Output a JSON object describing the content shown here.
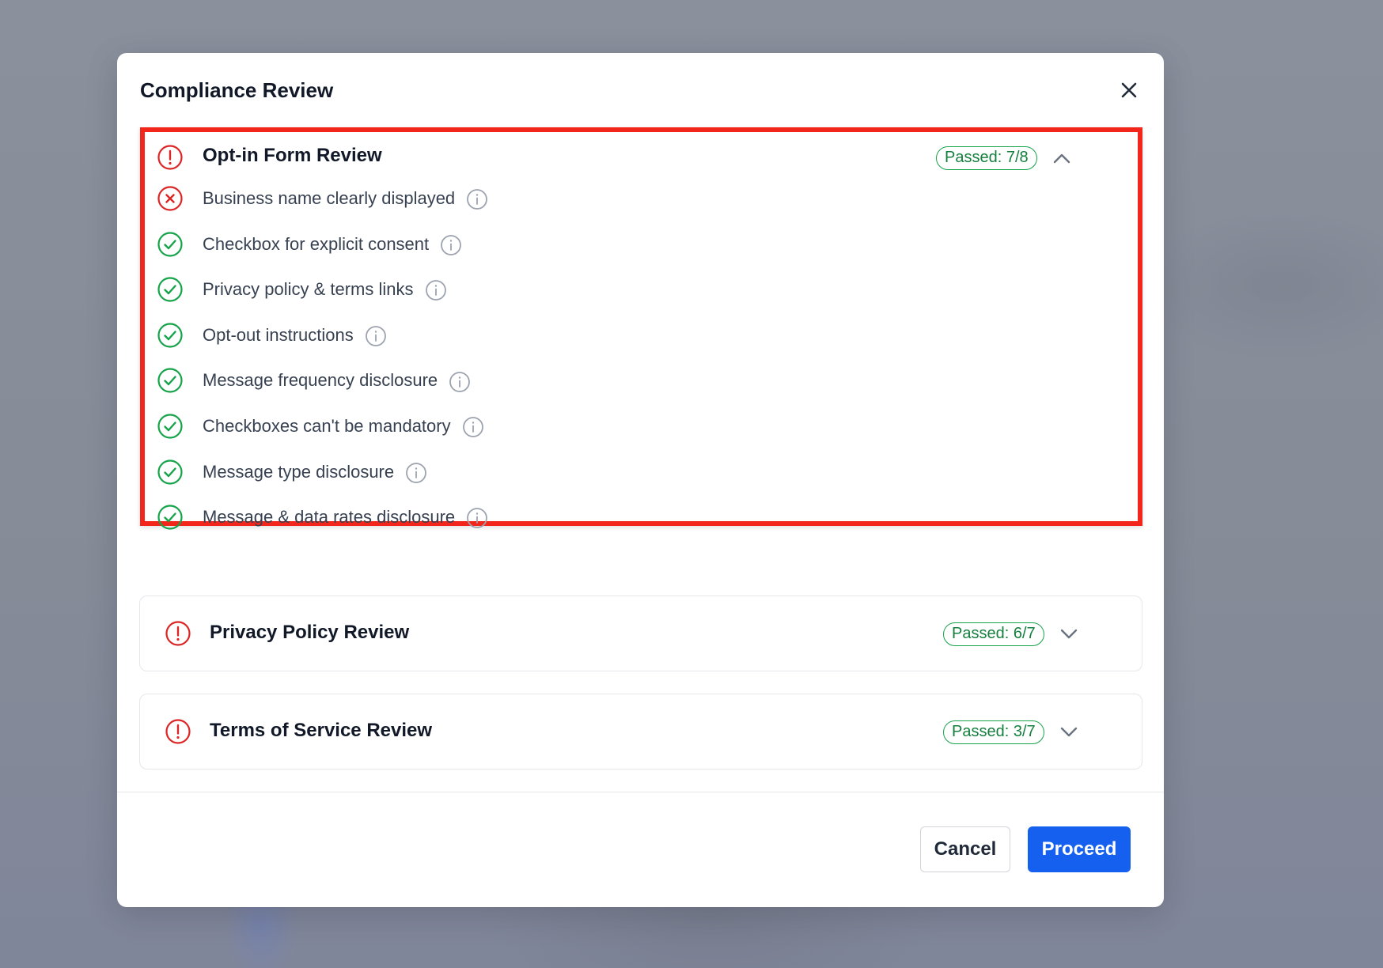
{
  "modal": {
    "title": "Compliance Review",
    "close_label": "close"
  },
  "sections": [
    {
      "title": "Opt-in Form Review",
      "badge": "Passed: 7/8",
      "status": "warning",
      "expanded": true,
      "items": [
        {
          "label": "Business name clearly displayed",
          "status": "fail"
        },
        {
          "label": "Checkbox for explicit consent",
          "status": "pass"
        },
        {
          "label": "Privacy policy & terms links",
          "status": "pass"
        },
        {
          "label": "Opt-out instructions",
          "status": "pass"
        },
        {
          "label": "Message frequency disclosure",
          "status": "pass"
        },
        {
          "label": "Checkboxes can't be mandatory",
          "status": "pass"
        },
        {
          "label": "Message type disclosure",
          "status": "pass"
        },
        {
          "label": "Message & data rates disclosure",
          "status": "pass"
        }
      ]
    },
    {
      "title": "Privacy Policy Review",
      "badge": "Passed: 6/7",
      "status": "warning",
      "expanded": false
    },
    {
      "title": "Terms of Service Review",
      "badge": "Passed: 3/7",
      "status": "warning",
      "expanded": false
    }
  ],
  "footer": {
    "cancel_label": "Cancel",
    "proceed_label": "Proceed"
  },
  "colors": {
    "error_red": "#dc2626",
    "success_green": "#16a34a",
    "primary_blue": "#1660f0",
    "highlight_red": "#f3261c"
  }
}
